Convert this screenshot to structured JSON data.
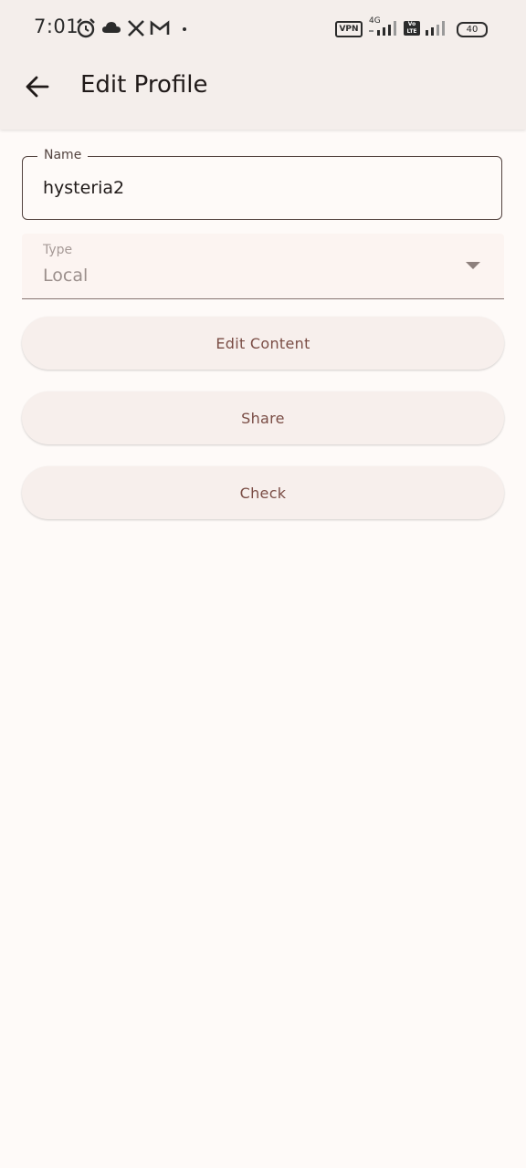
{
  "status_bar": {
    "time": "7:01",
    "battery": "40",
    "icons": [
      "alarm-icon",
      "cloud-icon",
      "x-app-icon",
      "gmail-icon",
      "dot-icon",
      "vpn-icon",
      "network-4g-icon",
      "signal-icon",
      "volte-icon",
      "signal-icon",
      "battery-icon"
    ],
    "vpn_label": "VPN",
    "network_label": "4G",
    "volte_label": "Vo LTE"
  },
  "app_bar": {
    "title": "Edit Profile",
    "back_icon": "arrow-back-icon"
  },
  "form": {
    "name": {
      "label": "Name",
      "value": "hysteria2"
    },
    "type": {
      "label": "Type",
      "value": "Local"
    }
  },
  "buttons": {
    "edit_content": "Edit Content",
    "share": "Share",
    "check": "Check"
  },
  "colors": {
    "background": "#fefaf8",
    "app_bar": "#f4eeeb",
    "button_bg": "#f7efec",
    "button_text": "#7a4d45",
    "outline": "#53433f"
  }
}
